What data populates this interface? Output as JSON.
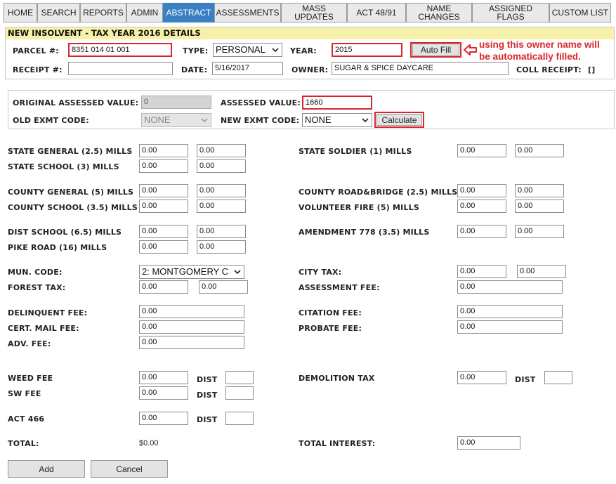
{
  "nav": {
    "tabs": [
      {
        "label": "HOME"
      },
      {
        "label": "SEARCH"
      },
      {
        "label": "REPORTS"
      },
      {
        "label": "ADMIN"
      },
      {
        "label": "ABSTRACT"
      },
      {
        "label": "ASSESSMENTS"
      },
      {
        "label": "MASS UPDATES"
      },
      {
        "label": "ACT 48/91"
      },
      {
        "label": "NAME CHANGES"
      },
      {
        "label": "ASSIGNED FLAGS"
      },
      {
        "label": "CUSTOM LIST"
      }
    ],
    "active": "ABSTRACT"
  },
  "details": {
    "header": "NEW INSOLVENT - TAX YEAR 2016 DETAILS",
    "parcel_label": "PARCEL #:",
    "parcel_value": "8351 014 01 001",
    "type_label": "TYPE:",
    "type_value": "PERSONAL",
    "year_label": "YEAR:",
    "year_value": "2015",
    "autofill_label": "Auto Fill",
    "receipt_label": "RECEIPT #:",
    "receipt_value": "",
    "date_label": "DATE:",
    "date_value": "5/16/2017",
    "owner_label": "OWNER:",
    "owner_value": "SUGAR & SPICE DAYCARE",
    "coll_receipt_label": "COLL RECEIPT:",
    "coll_receipt_checkbox": "[]",
    "annotation_line1": "using this owner name will",
    "annotation_line2": "be automatically filled."
  },
  "assessment": {
    "orig_label": "ORIGINAL ASSESSED VALUE:",
    "orig_value": "0",
    "assessed_label": "ASSESSED VALUE:",
    "assessed_value": "1660",
    "old_exmt_label": "OLD EXMT CODE:",
    "old_exmt_value": "NONE",
    "new_exmt_label": "NEW EXMT CODE:",
    "new_exmt_value": "NONE",
    "calculate_label": "Calculate"
  },
  "mills": {
    "state_general": {
      "label": "STATE GENERAL (2.5) MILLS",
      "v1": "0.00",
      "v2": "0.00"
    },
    "state_school": {
      "label": "STATE SCHOOL (3) MILLS",
      "v1": "0.00",
      "v2": "0.00"
    },
    "county_general": {
      "label": "COUNTY GENERAL (5) MILLS",
      "v1": "0.00",
      "v2": "0.00"
    },
    "county_school": {
      "label": "COUNTY SCHOOL (3.5) MILLS",
      "v1": "0.00",
      "v2": "0.00"
    },
    "dist_school": {
      "label": "DIST SCHOOL (6.5) MILLS",
      "v1": "0.00",
      "v2": "0.00"
    },
    "pike_road": {
      "label": "PIKE ROAD (16) MILLS",
      "v1": "0.00",
      "v2": "0.00"
    },
    "state_soldier": {
      "label": "STATE SOLDIER (1) MILLS",
      "v1": "0.00",
      "v2": "0.00"
    },
    "county_road": {
      "label": "COUNTY ROAD&BRIDGE (2.5) MILLS",
      "v1": "0.00",
      "v2": "0.00"
    },
    "volunteer_fire": {
      "label": "VOLUNTEER FIRE (5) MILLS",
      "v1": "0.00",
      "v2": "0.00"
    },
    "amendment": {
      "label": "AMENDMENT 778 (3.5) MILLS",
      "v1": "0.00",
      "v2": "0.00"
    }
  },
  "other": {
    "mun_code_label": "MUN. CODE:",
    "mun_code_value": "2: MONTGOMERY C",
    "forest_label": "FOREST TAX:",
    "forest_v1": "0.00",
    "forest_v2": "0.00",
    "city_label": "CITY TAX:",
    "city_v1": "0.00",
    "city_v2": "0.00",
    "assessment_fee_label": "ASSESSMENT FEE:",
    "assessment_fee_value": "0.00",
    "delinquent_label": "DELINQUENT FEE:",
    "delinquent_value": "0.00",
    "cert_mail_label": "CERT. MAIL FEE:",
    "cert_mail_value": "0.00",
    "adv_label": "ADV. FEE:",
    "adv_value": "0.00",
    "citation_label": "CITATION FEE:",
    "citation_value": "0.00",
    "probate_label": "PROBATE FEE:",
    "probate_value": "0.00",
    "weed_label": "WEED FEE",
    "weed_value": "0.00",
    "sw_label": "SW FEE",
    "sw_value": "0.00",
    "act466_label": "ACT 466",
    "act466_value": "0.00",
    "dist_label": "DIST",
    "demolition_label": "DEMOLITION TAX",
    "demolition_value": "0.00",
    "total_label": "TOTAL:",
    "total_value": "$0.00",
    "total_interest_label": "TOTAL INTEREST:",
    "total_interest_value": "0.00"
  },
  "actions": {
    "add_label": "Add",
    "cancel_label": "Cancel"
  },
  "colors": {
    "accent": "#3a7fc1",
    "highlight": "#d9262c",
    "header_bg": "#f6f0a8"
  }
}
